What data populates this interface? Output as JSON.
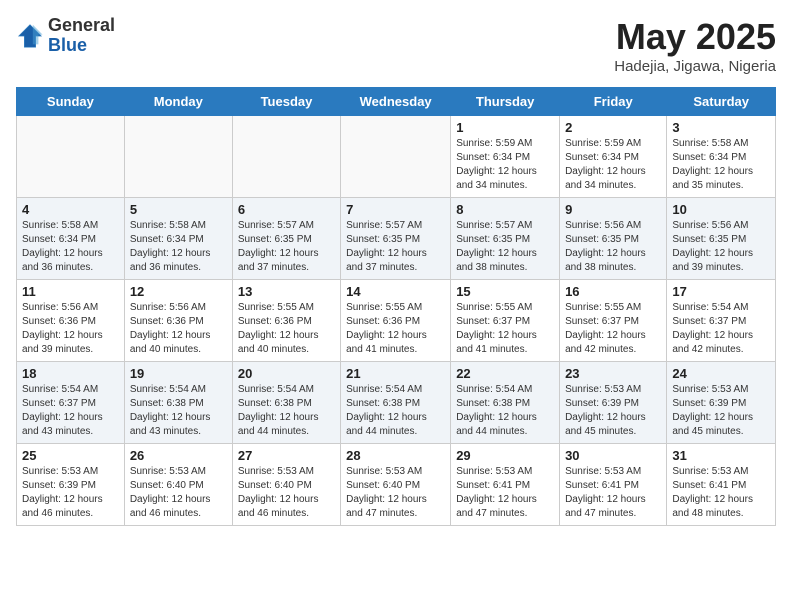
{
  "logo": {
    "general": "General",
    "blue": "Blue"
  },
  "title": {
    "month_year": "May 2025",
    "location": "Hadejia, Jigawa, Nigeria"
  },
  "days_of_week": [
    "Sunday",
    "Monday",
    "Tuesday",
    "Wednesday",
    "Thursday",
    "Friday",
    "Saturday"
  ],
  "weeks": [
    [
      {
        "num": "",
        "info": ""
      },
      {
        "num": "",
        "info": ""
      },
      {
        "num": "",
        "info": ""
      },
      {
        "num": "",
        "info": ""
      },
      {
        "num": "1",
        "info": "Sunrise: 5:59 AM\nSunset: 6:34 PM\nDaylight: 12 hours\nand 34 minutes."
      },
      {
        "num": "2",
        "info": "Sunrise: 5:59 AM\nSunset: 6:34 PM\nDaylight: 12 hours\nand 34 minutes."
      },
      {
        "num": "3",
        "info": "Sunrise: 5:58 AM\nSunset: 6:34 PM\nDaylight: 12 hours\nand 35 minutes."
      }
    ],
    [
      {
        "num": "4",
        "info": "Sunrise: 5:58 AM\nSunset: 6:34 PM\nDaylight: 12 hours\nand 36 minutes."
      },
      {
        "num": "5",
        "info": "Sunrise: 5:58 AM\nSunset: 6:34 PM\nDaylight: 12 hours\nand 36 minutes."
      },
      {
        "num": "6",
        "info": "Sunrise: 5:57 AM\nSunset: 6:35 PM\nDaylight: 12 hours\nand 37 minutes."
      },
      {
        "num": "7",
        "info": "Sunrise: 5:57 AM\nSunset: 6:35 PM\nDaylight: 12 hours\nand 37 minutes."
      },
      {
        "num": "8",
        "info": "Sunrise: 5:57 AM\nSunset: 6:35 PM\nDaylight: 12 hours\nand 38 minutes."
      },
      {
        "num": "9",
        "info": "Sunrise: 5:56 AM\nSunset: 6:35 PM\nDaylight: 12 hours\nand 38 minutes."
      },
      {
        "num": "10",
        "info": "Sunrise: 5:56 AM\nSunset: 6:35 PM\nDaylight: 12 hours\nand 39 minutes."
      }
    ],
    [
      {
        "num": "11",
        "info": "Sunrise: 5:56 AM\nSunset: 6:36 PM\nDaylight: 12 hours\nand 39 minutes."
      },
      {
        "num": "12",
        "info": "Sunrise: 5:56 AM\nSunset: 6:36 PM\nDaylight: 12 hours\nand 40 minutes."
      },
      {
        "num": "13",
        "info": "Sunrise: 5:55 AM\nSunset: 6:36 PM\nDaylight: 12 hours\nand 40 minutes."
      },
      {
        "num": "14",
        "info": "Sunrise: 5:55 AM\nSunset: 6:36 PM\nDaylight: 12 hours\nand 41 minutes."
      },
      {
        "num": "15",
        "info": "Sunrise: 5:55 AM\nSunset: 6:37 PM\nDaylight: 12 hours\nand 41 minutes."
      },
      {
        "num": "16",
        "info": "Sunrise: 5:55 AM\nSunset: 6:37 PM\nDaylight: 12 hours\nand 42 minutes."
      },
      {
        "num": "17",
        "info": "Sunrise: 5:54 AM\nSunset: 6:37 PM\nDaylight: 12 hours\nand 42 minutes."
      }
    ],
    [
      {
        "num": "18",
        "info": "Sunrise: 5:54 AM\nSunset: 6:37 PM\nDaylight: 12 hours\nand 43 minutes."
      },
      {
        "num": "19",
        "info": "Sunrise: 5:54 AM\nSunset: 6:38 PM\nDaylight: 12 hours\nand 43 minutes."
      },
      {
        "num": "20",
        "info": "Sunrise: 5:54 AM\nSunset: 6:38 PM\nDaylight: 12 hours\nand 44 minutes."
      },
      {
        "num": "21",
        "info": "Sunrise: 5:54 AM\nSunset: 6:38 PM\nDaylight: 12 hours\nand 44 minutes."
      },
      {
        "num": "22",
        "info": "Sunrise: 5:54 AM\nSunset: 6:38 PM\nDaylight: 12 hours\nand 44 minutes."
      },
      {
        "num": "23",
        "info": "Sunrise: 5:53 AM\nSunset: 6:39 PM\nDaylight: 12 hours\nand 45 minutes."
      },
      {
        "num": "24",
        "info": "Sunrise: 5:53 AM\nSunset: 6:39 PM\nDaylight: 12 hours\nand 45 minutes."
      }
    ],
    [
      {
        "num": "25",
        "info": "Sunrise: 5:53 AM\nSunset: 6:39 PM\nDaylight: 12 hours\nand 46 minutes."
      },
      {
        "num": "26",
        "info": "Sunrise: 5:53 AM\nSunset: 6:40 PM\nDaylight: 12 hours\nand 46 minutes."
      },
      {
        "num": "27",
        "info": "Sunrise: 5:53 AM\nSunset: 6:40 PM\nDaylight: 12 hours\nand 46 minutes."
      },
      {
        "num": "28",
        "info": "Sunrise: 5:53 AM\nSunset: 6:40 PM\nDaylight: 12 hours\nand 47 minutes."
      },
      {
        "num": "29",
        "info": "Sunrise: 5:53 AM\nSunset: 6:41 PM\nDaylight: 12 hours\nand 47 minutes."
      },
      {
        "num": "30",
        "info": "Sunrise: 5:53 AM\nSunset: 6:41 PM\nDaylight: 12 hours\nand 47 minutes."
      },
      {
        "num": "31",
        "info": "Sunrise: 5:53 AM\nSunset: 6:41 PM\nDaylight: 12 hours\nand 48 minutes."
      }
    ]
  ]
}
